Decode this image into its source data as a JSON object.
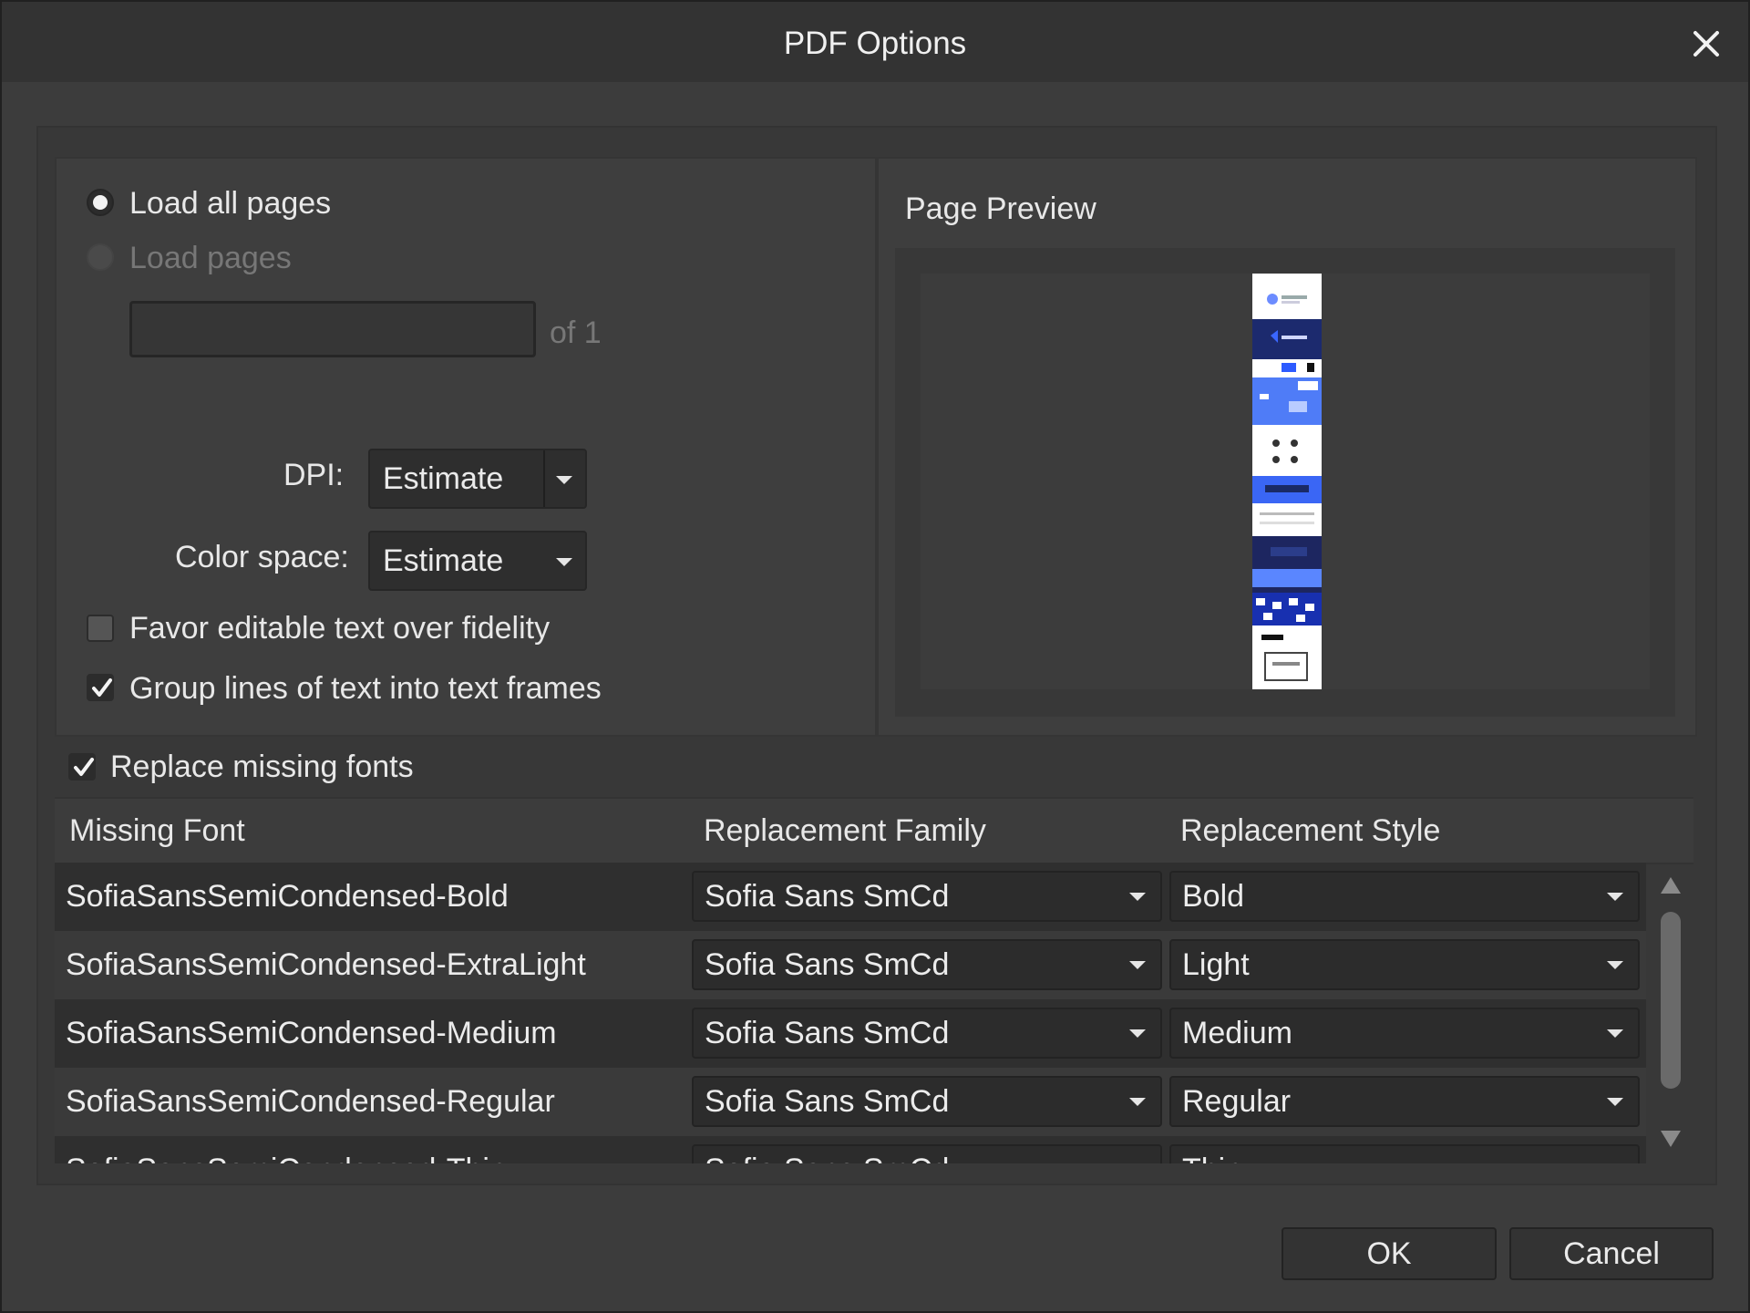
{
  "dialog": {
    "title": "PDF Options"
  },
  "pages": {
    "load_all_label": "Load all pages",
    "load_pages_label": "Load pages",
    "load_all_selected": true,
    "pages_input_value": "",
    "of_label": "of 1"
  },
  "options": {
    "dpi_label": "DPI:",
    "dpi_value": "Estimate",
    "color_space_label": "Color space:",
    "color_space_value": "Estimate",
    "favor_editable_label": "Favor editable text over fidelity",
    "favor_editable_checked": false,
    "group_lines_label": "Group lines of text into text frames",
    "group_lines_checked": true
  },
  "preview": {
    "title": "Page Preview"
  },
  "fonts": {
    "replace_missing_label": "Replace missing fonts",
    "replace_missing_checked": true,
    "columns": [
      "Missing Font",
      "Replacement Family",
      "Replacement Style"
    ],
    "rows": [
      {
        "missing": "SofiaSansSemiCondensed-Bold",
        "family": "Sofia Sans SmCd",
        "style": "Bold"
      },
      {
        "missing": "SofiaSansSemiCondensed-ExtraLight",
        "family": "Sofia Sans SmCd",
        "style": "Light"
      },
      {
        "missing": "SofiaSansSemiCondensed-Medium",
        "family": "Sofia Sans SmCd",
        "style": "Medium"
      },
      {
        "missing": "SofiaSansSemiCondensed-Regular",
        "family": "Sofia Sans SmCd",
        "style": "Regular"
      },
      {
        "missing": "SofiaSansSemiCondensed-Thin",
        "family": "Sofia Sans SmCd",
        "style": "Thin"
      }
    ]
  },
  "buttons": {
    "ok": "OK",
    "cancel": "Cancel"
  }
}
